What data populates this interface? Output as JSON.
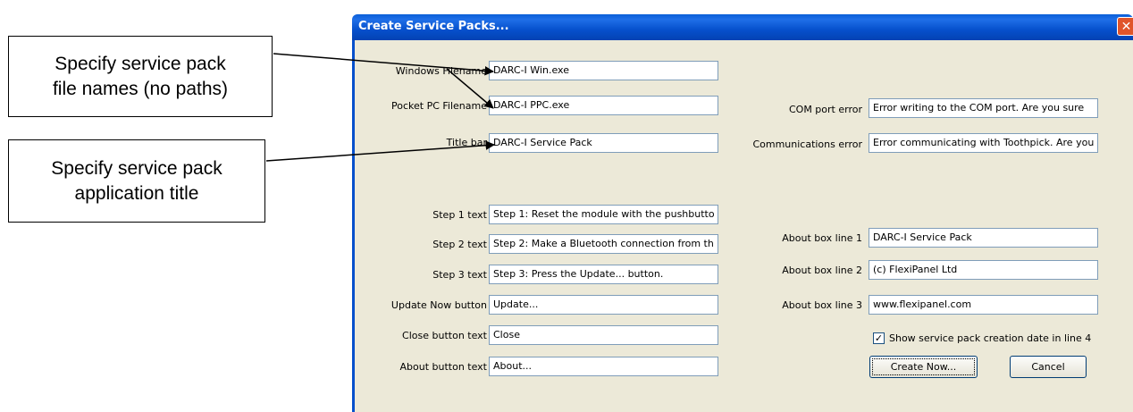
{
  "callouts": {
    "filenames": [
      "Specify service pack",
      "file names (no paths)"
    ],
    "title": [
      "Specify service pack",
      "application title"
    ]
  },
  "dialog": {
    "title": "Create Service Packs...",
    "close_symbol": "✕"
  },
  "left_fields": [
    {
      "label": "Windows Filename",
      "value": "DARC-I Win.exe"
    },
    {
      "label": "Pocket PC Filename",
      "value": "DARC-I PPC.exe"
    },
    {
      "label": "Title bar",
      "value": "DARC-I Service Pack"
    },
    {
      "label": "Step 1 text",
      "value": "Step 1: Reset the module with the pushbutto"
    },
    {
      "label": "Step 2 text",
      "value": "Step 2: Make a Bluetooth connection from th"
    },
    {
      "label": "Step 3 text",
      "value": "Step 3: Press the Update... button."
    },
    {
      "label": "Update Now button",
      "value": "Update..."
    },
    {
      "label": "Close button text",
      "value": "Close"
    },
    {
      "label": "About button text",
      "value": "About..."
    }
  ],
  "right_fields": [
    {
      "label": "COM port error",
      "value": "Error writing to the COM port.  Are you sure"
    },
    {
      "label": "Communications error",
      "value": "Error communicating with Toothpick.  Are you"
    },
    {
      "label": "About box line 1",
      "value": "DARC-I Service Pack"
    },
    {
      "label": "About box line 2",
      "value": "(c) FlexiPanel Ltd"
    },
    {
      "label": "About box line 3",
      "value": "www.flexipanel.com"
    }
  ],
  "checkbox": {
    "label": "Show service pack creation date in line 4",
    "checked": true,
    "mark": "✓"
  },
  "buttons": {
    "create": "Create Now...",
    "cancel": "Cancel"
  }
}
